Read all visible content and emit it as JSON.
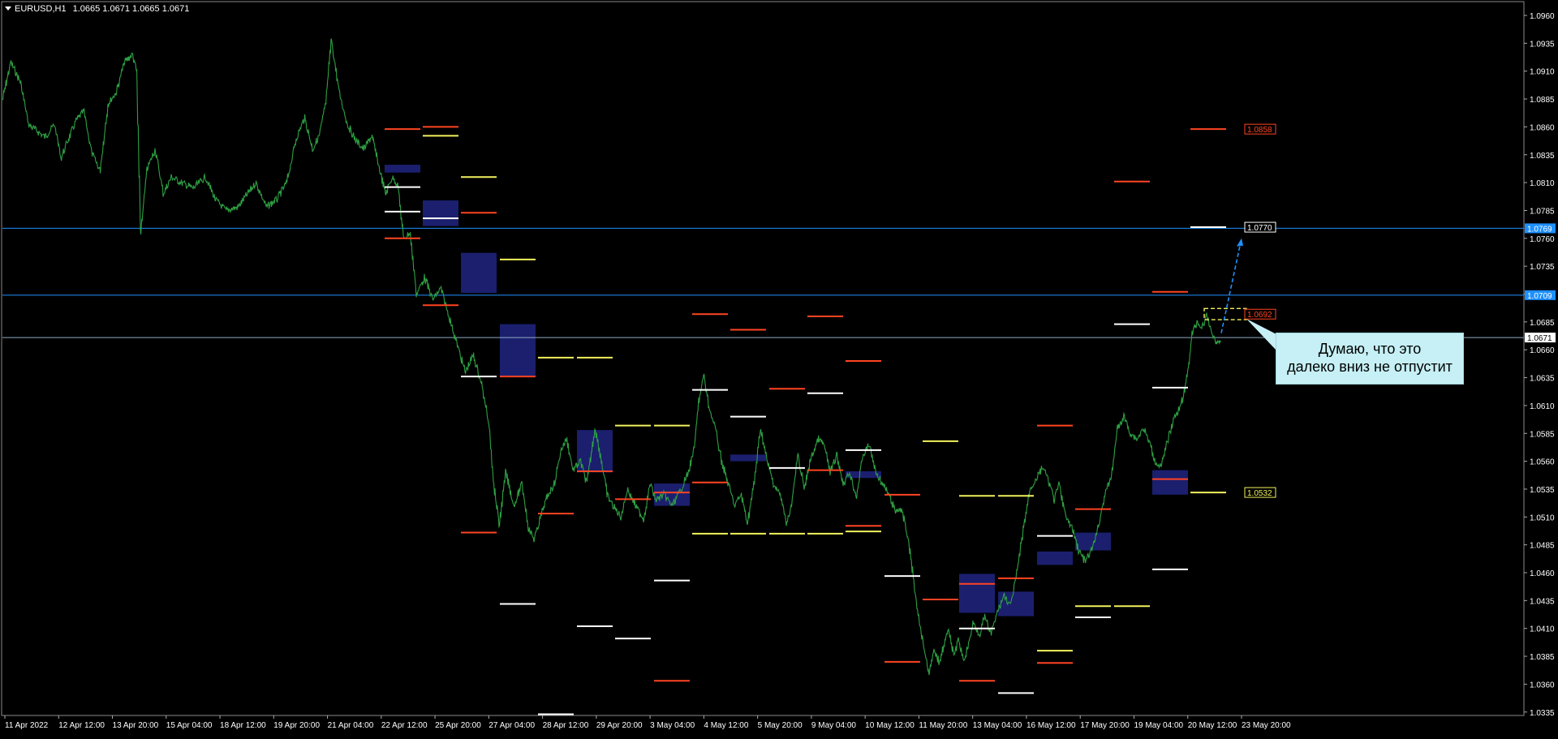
{
  "header": {
    "symbol": "EURUSD,H1",
    "ohlc": [
      "1.0665",
      "1.0671",
      "1.0665",
      "1.0671"
    ]
  },
  "callout": {
    "line1": "Думаю, что это",
    "line2": "далеко вниз не отпустит"
  },
  "colors": {
    "background": "#000000",
    "candles": "#2ea043",
    "hline": "#1e90ff",
    "zone": "#1b1f6e",
    "level_red": "#ff4422",
    "level_yellow": "#f2f25c",
    "level_white": "#ffffff",
    "grid_text": "#ffffff",
    "arrow": "#1e90ff",
    "box": "#f2f25c"
  },
  "chart_data": {
    "type": "line",
    "title": "EURUSD,H1",
    "ylim": [
      1.0327,
      1.0973
    ],
    "y_ticks": [
      "1.0960",
      "1.0935",
      "1.0910",
      "1.0885",
      "1.0860",
      "1.0835",
      "1.0810",
      "1.0785",
      "1.0760",
      "1.0735",
      "1.0710",
      "1.0685",
      "1.0660",
      "1.0635",
      "1.0610",
      "1.0585",
      "1.0560",
      "1.0535",
      "1.0510",
      "1.0485",
      "1.0460",
      "1.0435",
      "1.0410",
      "1.0385",
      "1.0360",
      "1.0335"
    ],
    "x_ticks": [
      "11 Apr 2022",
      "12 Apr 12:00",
      "13 Apr 20:00",
      "15 Apr 04:00",
      "18 Apr 12:00",
      "19 Apr 20:00",
      "21 Apr 04:00",
      "22 Apr 12:00",
      "25 Apr 20:00",
      "27 Apr 04:00",
      "28 Apr 12:00",
      "29 Apr 20:00",
      "3 May 04:00",
      "4 May 12:00",
      "5 May 20:00",
      "9 May 04:00",
      "10 May 12:00",
      "11 May 20:00",
      "13 May 04:00",
      "16 May 12:00",
      "17 May 20:00",
      "19 May 04:00",
      "20 May 12:00",
      "23 May 20:00"
    ],
    "price_path": [
      [
        0,
        1.0885
      ],
      [
        10,
        1.0918
      ],
      [
        22,
        1.09
      ],
      [
        32,
        1.0862
      ],
      [
        52,
        1.0851
      ],
      [
        64,
        1.0862
      ],
      [
        72,
        1.0832
      ],
      [
        80,
        1.0847
      ],
      [
        90,
        1.0865
      ],
      [
        100,
        1.0874
      ],
      [
        110,
        1.0836
      ],
      [
        120,
        1.0821
      ],
      [
        130,
        1.0881
      ],
      [
        140,
        1.0891
      ],
      [
        150,
        1.0918
      ],
      [
        160,
        1.0925
      ],
      [
        165,
        1.091
      ],
      [
        170,
        1.0765
      ],
      [
        178,
        1.0822
      ],
      [
        188,
        1.084
      ],
      [
        198,
        1.08
      ],
      [
        208,
        1.0815
      ],
      [
        220,
        1.081
      ],
      [
        235,
        1.0805
      ],
      [
        250,
        1.0815
      ],
      [
        262,
        1.0795
      ],
      [
        275,
        1.0785
      ],
      [
        290,
        1.0788
      ],
      [
        300,
        1.0798
      ],
      [
        312,
        1.081
      ],
      [
        325,
        1.0788
      ],
      [
        338,
        1.0795
      ],
      [
        350,
        1.081
      ],
      [
        362,
        1.085
      ],
      [
        372,
        1.0868
      ],
      [
        382,
        1.084
      ],
      [
        390,
        1.0852
      ],
      [
        398,
        1.088
      ],
      [
        405,
        1.0938
      ],
      [
        415,
        1.089
      ],
      [
        425,
        1.0862
      ],
      [
        435,
        1.0848
      ],
      [
        445,
        1.084
      ],
      [
        455,
        1.0852
      ],
      [
        465,
        1.082
      ],
      [
        472,
        1.08
      ],
      [
        480,
        1.0815
      ],
      [
        487,
        1.0808
      ],
      [
        494,
        1.076
      ],
      [
        502,
        1.0765
      ],
      [
        510,
        1.071
      ],
      [
        520,
        1.0725
      ],
      [
        530,
        1.0705
      ],
      [
        540,
        1.0715
      ],
      [
        550,
        1.069
      ],
      [
        560,
        1.0665
      ],
      [
        570,
        1.064
      ],
      [
        580,
        1.0655
      ],
      [
        590,
        1.063
      ],
      [
        600,
        1.059
      ],
      [
        605,
        1.054
      ],
      [
        612,
        1.0503
      ],
      [
        620,
        1.055
      ],
      [
        630,
        1.052
      ],
      [
        640,
        1.054
      ],
      [
        648,
        1.05
      ],
      [
        655,
        1.049
      ],
      [
        665,
        1.0515
      ],
      [
        672,
        1.053
      ],
      [
        680,
        1.054
      ],
      [
        688,
        1.057
      ],
      [
        695,
        1.058
      ],
      [
        703,
        1.0552
      ],
      [
        712,
        1.056
      ],
      [
        720,
        1.054
      ],
      [
        730,
        1.059
      ],
      [
        738,
        1.056
      ],
      [
        745,
        1.053
      ],
      [
        752,
        1.052
      ],
      [
        762,
        1.051
      ],
      [
        770,
        1.0535
      ],
      [
        780,
        1.052
      ],
      [
        790,
        1.0508
      ],
      [
        798,
        1.054
      ],
      [
        805,
        1.0525
      ],
      [
        815,
        1.053
      ],
      [
        825,
        1.052
      ],
      [
        835,
        1.0533
      ],
      [
        845,
        1.055
      ],
      [
        852,
        1.057
      ],
      [
        858,
        1.0615
      ],
      [
        864,
        1.0637
      ],
      [
        870,
        1.061
      ],
      [
        878,
        1.059
      ],
      [
        886,
        1.056
      ],
      [
        894,
        1.054
      ],
      [
        902,
        1.052
      ],
      [
        910,
        1.053
      ],
      [
        918,
        1.0505
      ],
      [
        926,
        1.054
      ],
      [
        934,
        1.059
      ],
      [
        942,
        1.056
      ],
      [
        950,
        1.054
      ],
      [
        958,
        1.053
      ],
      [
        966,
        1.0505
      ],
      [
        972,
        1.052
      ],
      [
        980,
        1.0565
      ],
      [
        988,
        1.0535
      ],
      [
        995,
        1.056
      ],
      [
        1005,
        1.058
      ],
      [
        1012,
        1.0575
      ],
      [
        1020,
        1.055
      ],
      [
        1028,
        1.0565
      ],
      [
        1036,
        1.054
      ],
      [
        1044,
        1.055
      ],
      [
        1052,
        1.0528
      ],
      [
        1060,
        1.0565
      ],
      [
        1068,
        1.0575
      ],
      [
        1076,
        1.055
      ],
      [
        1084,
        1.054
      ],
      [
        1092,
        1.053
      ],
      [
        1100,
        1.0515
      ],
      [
        1106,
        1.0518
      ],
      [
        1112,
        1.0505
      ],
      [
        1118,
        1.048
      ],
      [
        1124,
        1.0445
      ],
      [
        1130,
        1.0415
      ],
      [
        1136,
        1.039
      ],
      [
        1142,
        1.037
      ],
      [
        1148,
        1.039
      ],
      [
        1154,
        1.038
      ],
      [
        1160,
        1.0395
      ],
      [
        1166,
        1.041
      ],
      [
        1172,
        1.0385
      ],
      [
        1178,
        1.04
      ],
      [
        1184,
        1.038
      ],
      [
        1190,
        1.0395
      ],
      [
        1196,
        1.0415
      ],
      [
        1204,
        1.0405
      ],
      [
        1210,
        1.042
      ],
      [
        1218,
        1.0405
      ],
      [
        1226,
        1.0425
      ],
      [
        1234,
        1.044
      ],
      [
        1242,
        1.043
      ],
      [
        1250,
        1.046
      ],
      [
        1258,
        1.05
      ],
      [
        1266,
        1.0535
      ],
      [
        1274,
        1.0545
      ],
      [
        1282,
        1.0555
      ],
      [
        1290,
        1.054
      ],
      [
        1296,
        1.0525
      ],
      [
        1302,
        1.054
      ],
      [
        1310,
        1.051
      ],
      [
        1318,
        1.05
      ],
      [
        1326,
        1.048
      ],
      [
        1334,
        1.047
      ],
      [
        1342,
        1.048
      ],
      [
        1350,
        1.05
      ],
      [
        1358,
        1.053
      ],
      [
        1366,
        1.0545
      ],
      [
        1374,
        1.059
      ],
      [
        1382,
        1.06
      ],
      [
        1390,
        1.0585
      ],
      [
        1398,
        1.058
      ],
      [
        1406,
        1.059
      ],
      [
        1414,
        1.0575
      ],
      [
        1420,
        1.056
      ],
      [
        1428,
        1.0555
      ],
      [
        1436,
        1.058
      ],
      [
        1444,
        1.06
      ],
      [
        1452,
        1.061
      ],
      [
        1458,
        1.0628
      ],
      [
        1462,
        1.065
      ],
      [
        1466,
        1.0675
      ],
      [
        1472,
        1.0685
      ],
      [
        1478,
        1.068
      ],
      [
        1484,
        1.069
      ],
      [
        1490,
        1.0676
      ],
      [
        1496,
        1.0665
      ],
      [
        1502,
        1.0671
      ]
    ],
    "hlines": [
      {
        "price": 1.0769,
        "label": "1.0769"
      },
      {
        "price": 1.0709,
        "label": "1.0709"
      },
      {
        "price": 1.0671,
        "label": "1.0671"
      }
    ],
    "tags": [
      {
        "x": 1534,
        "price": 1.0858,
        "label": "1.0858",
        "color": "red"
      },
      {
        "x": 1534,
        "price": 1.077,
        "label": "1.0770",
        "color": "white"
      },
      {
        "x": 1534,
        "price": 1.0692,
        "label": "1.0692",
        "color": "red"
      },
      {
        "x": 1534,
        "price": 1.0532,
        "label": "1.0532",
        "color": "yellow"
      }
    ],
    "zones": [
      [
        474,
        1.0826,
        1.0819
      ],
      [
        521,
        1.0794,
        1.0771
      ],
      [
        568,
        1.0747,
        1.0711
      ],
      [
        616,
        1.0683,
        1.0636
      ],
      [
        711,
        1.0588,
        1.055
      ],
      [
        806,
        1.054,
        1.052
      ],
      [
        900,
        1.0566,
        1.056
      ],
      [
        1042,
        1.0551,
        1.0545
      ],
      [
        1182,
        1.0459,
        1.0424
      ],
      [
        1230,
        1.0443,
        1.0421
      ],
      [
        1278,
        1.0479,
        1.0467
      ],
      [
        1325,
        1.0496,
        1.048
      ],
      [
        1420,
        1.0552,
        1.053
      ]
    ],
    "levels": [
      [
        474,
        "red",
        1.0858
      ],
      [
        474,
        "white",
        1.0806
      ],
      [
        474,
        "white",
        1.0784
      ],
      [
        474,
        "red",
        1.076
      ],
      [
        521,
        "red",
        1.086
      ],
      [
        521,
        "yellow",
        1.0852
      ],
      [
        521,
        "white",
        1.0778
      ],
      [
        521,
        "red",
        1.07
      ],
      [
        568,
        "yellow",
        1.0815
      ],
      [
        568,
        "red",
        1.0783
      ],
      [
        568,
        "white",
        1.0636
      ],
      [
        568,
        "red",
        1.0496
      ],
      [
        616,
        "yellow",
        1.0741
      ],
      [
        616,
        "red",
        1.0636
      ],
      [
        616,
        "white",
        1.0432
      ],
      [
        663,
        "yellow",
        1.0653
      ],
      [
        663,
        "red",
        1.0513
      ],
      [
        663,
        "white",
        1.0333
      ],
      [
        711,
        "yellow",
        1.0653
      ],
      [
        711,
        "red",
        1.0551
      ],
      [
        711,
        "white",
        1.0412
      ],
      [
        758,
        "yellow",
        1.0592
      ],
      [
        758,
        "red",
        1.0526
      ],
      [
        758,
        "white",
        1.0401
      ],
      [
        806,
        "yellow",
        1.0592
      ],
      [
        806,
        "red",
        1.0532
      ],
      [
        806,
        "white",
        1.0453
      ],
      [
        806,
        "red",
        1.0363
      ],
      [
        853,
        "red",
        1.0692
      ],
      [
        853,
        "white",
        1.0624
      ],
      [
        853,
        "red",
        1.0541
      ],
      [
        853,
        "yellow",
        1.0495
      ],
      [
        900,
        "red",
        1.0678
      ],
      [
        900,
        "white",
        1.06
      ],
      [
        900,
        "yellow",
        1.0495
      ],
      [
        948,
        "red",
        1.0625
      ],
      [
        948,
        "white",
        1.0554
      ],
      [
        948,
        "yellow",
        1.0495
      ],
      [
        995,
        "red",
        1.069
      ],
      [
        995,
        "white",
        1.0621
      ],
      [
        995,
        "red",
        1.0552
      ],
      [
        995,
        "yellow",
        1.0495
      ],
      [
        1042,
        "red",
        1.065
      ],
      [
        1042,
        "white",
        1.057
      ],
      [
        1042,
        "red",
        1.0502
      ],
      [
        1042,
        "yellow",
        1.0497
      ],
      [
        1090,
        "red",
        1.053
      ],
      [
        1090,
        "white",
        1.0457
      ],
      [
        1090,
        "red",
        1.038
      ],
      [
        1137,
        "yellow",
        1.0578
      ],
      [
        1137,
        "red",
        1.0436
      ],
      [
        1182,
        "yellow",
        1.0529
      ],
      [
        1182,
        "red",
        1.045
      ],
      [
        1182,
        "white",
        1.041
      ],
      [
        1182,
        "red",
        1.0363
      ],
      [
        1230,
        "yellow",
        1.0529
      ],
      [
        1230,
        "red",
        1.0455
      ],
      [
        1230,
        "white",
        1.0352
      ],
      [
        1278,
        "red",
        1.0592
      ],
      [
        1278,
        "white",
        1.0493
      ],
      [
        1278,
        "yellow",
        1.039
      ],
      [
        1278,
        "red",
        1.0379
      ],
      [
        1325,
        "red",
        1.0517
      ],
      [
        1325,
        "yellow",
        1.043
      ],
      [
        1325,
        "white",
        1.042
      ],
      [
        1373,
        "red",
        1.0811
      ],
      [
        1373,
        "white",
        1.0683
      ],
      [
        1373,
        "yellow",
        1.043
      ],
      [
        1420,
        "red",
        1.0712
      ],
      [
        1420,
        "white",
        1.0626
      ],
      [
        1420,
        "red",
        1.0544
      ],
      [
        1420,
        "white",
        1.0463
      ],
      [
        1467,
        "red",
        1.0858
      ],
      [
        1467,
        "white",
        1.077
      ],
      [
        1467,
        "yellow",
        1.0532
      ]
    ]
  }
}
